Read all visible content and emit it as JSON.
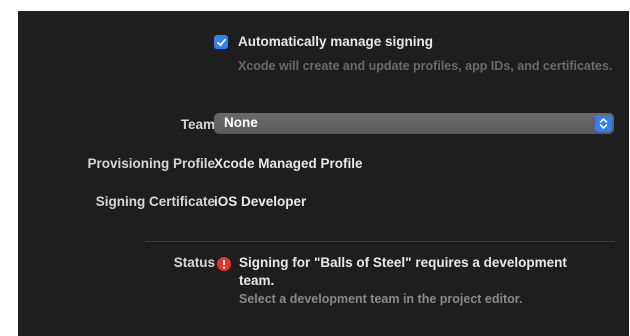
{
  "auto_signing": {
    "checked": true,
    "label": "Automatically manage signing",
    "description": "Xcode will create and update profiles, app IDs, and certificates.",
    "checkbox_color": "#2f7ff6"
  },
  "team": {
    "label": "Team",
    "value": "None"
  },
  "provisioning_profile": {
    "label": "Provisioning Profile",
    "value": "Xcode Managed Profile"
  },
  "signing_certificate": {
    "label": "Signing Certificate",
    "value": "iOS Developer"
  },
  "status": {
    "label": "Status",
    "message": "Signing for \"Balls of Steel\" requires a development team.",
    "hint": "Select a development team in the project editor.",
    "icon": "error-icon",
    "icon_color": "#e8302b"
  }
}
